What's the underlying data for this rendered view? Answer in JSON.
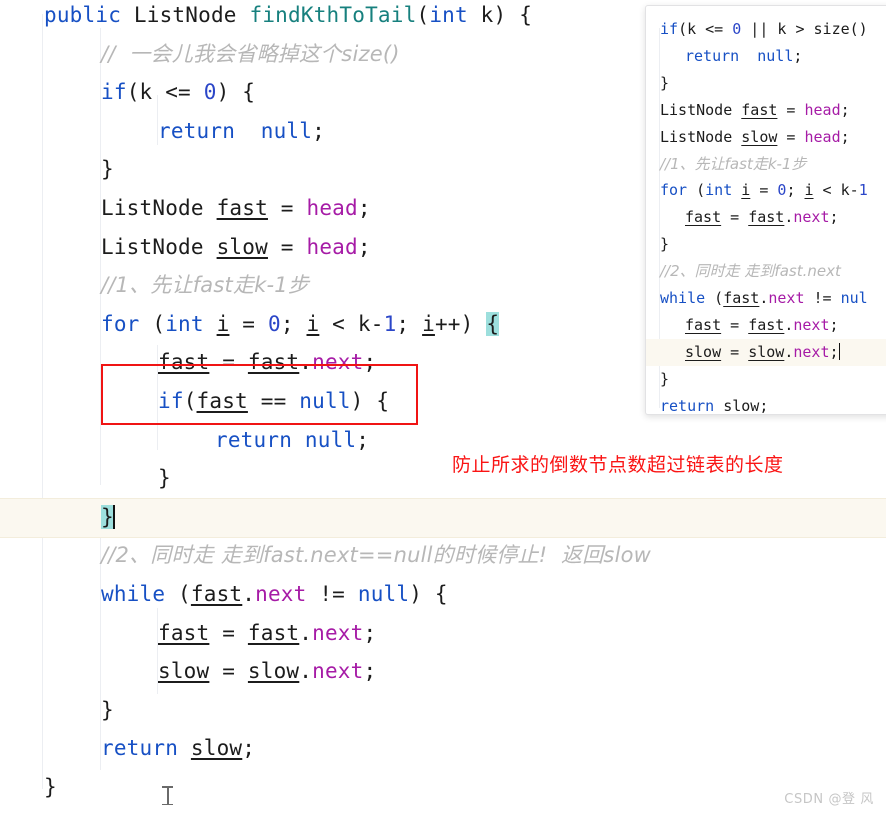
{
  "editor": {
    "language": "java",
    "colors": {
      "keyword": "#1750c4",
      "number": "#2b46c8",
      "method": "#17807e",
      "field": "#a61ba6",
      "comment": "#b7b7b7",
      "text": "#1c1c1c",
      "brace_match_highlight": "#9ddfdd",
      "current_line": "#fbf8f0",
      "annotation_red": "#f01414",
      "background": "#ffffff"
    },
    "lines": [
      {
        "n": 1,
        "indent": 0,
        "segments": [
          {
            "t": "public",
            "c": "kw"
          },
          {
            "t": " ",
            "c": "plain"
          },
          {
            "t": "ListNode",
            "c": "plain"
          },
          {
            "t": " ",
            "c": "plain"
          },
          {
            "t": "findKthToTail",
            "c": "fn"
          },
          {
            "t": "(",
            "c": "plain"
          },
          {
            "t": "int",
            "c": "kw"
          },
          {
            "t": " k) {",
            "c": "plain"
          }
        ]
      },
      {
        "n": 2,
        "indent": 1,
        "segments": [
          {
            "t": "//  一会儿我会省略掉这个size()",
            "c": "cmt"
          }
        ]
      },
      {
        "n": 3,
        "indent": 1,
        "segments": [
          {
            "t": "if",
            "c": "kw"
          },
          {
            "t": "(k <= ",
            "c": "plain"
          },
          {
            "t": "0",
            "c": "num"
          },
          {
            "t": ") {",
            "c": "plain"
          }
        ]
      },
      {
        "n": 4,
        "indent": 2,
        "segments": [
          {
            "t": "return",
            "c": "kw"
          },
          {
            "t": "  ",
            "c": "plain"
          },
          {
            "t": "null",
            "c": "kw"
          },
          {
            "t": ";",
            "c": "plain"
          }
        ]
      },
      {
        "n": 5,
        "indent": 1,
        "segments": [
          {
            "t": "}",
            "c": "plain"
          }
        ]
      },
      {
        "n": 6,
        "indent": 1,
        "segments": [
          {
            "t": "ListNode ",
            "c": "plain"
          },
          {
            "t": "fast",
            "c": "var"
          },
          {
            "t": " = ",
            "c": "plain"
          },
          {
            "t": "head",
            "c": "fld"
          },
          {
            "t": ";",
            "c": "plain"
          }
        ]
      },
      {
        "n": 7,
        "indent": 1,
        "segments": [
          {
            "t": "ListNode ",
            "c": "plain"
          },
          {
            "t": "slow",
            "c": "var"
          },
          {
            "t": " = ",
            "c": "plain"
          },
          {
            "t": "head",
            "c": "fld"
          },
          {
            "t": ";",
            "c": "plain"
          }
        ]
      },
      {
        "n": 8,
        "indent": 1,
        "segments": [
          {
            "t": "//1、先让fast走k-1步",
            "c": "cmt"
          }
        ]
      },
      {
        "n": 9,
        "indent": 1,
        "segments": [
          {
            "t": "for",
            "c": "kw"
          },
          {
            "t": " (",
            "c": "plain"
          },
          {
            "t": "int",
            "c": "kw"
          },
          {
            "t": " ",
            "c": "plain"
          },
          {
            "t": "i",
            "c": "var"
          },
          {
            "t": " = ",
            "c": "plain"
          },
          {
            "t": "0",
            "c": "num"
          },
          {
            "t": "; ",
            "c": "plain"
          },
          {
            "t": "i",
            "c": "var"
          },
          {
            "t": " < k-",
            "c": "plain"
          },
          {
            "t": "1",
            "c": "num"
          },
          {
            "t": "; ",
            "c": "plain"
          },
          {
            "t": "i",
            "c": "var"
          },
          {
            "t": "++) ",
            "c": "plain"
          },
          {
            "t": "{",
            "c": "brace-hl"
          }
        ]
      },
      {
        "n": 10,
        "indent": 2,
        "segments": [
          {
            "t": "fast",
            "c": "var"
          },
          {
            "t": " = ",
            "c": "plain"
          },
          {
            "t": "fast",
            "c": "var"
          },
          {
            "t": ".",
            "c": "plain"
          },
          {
            "t": "next",
            "c": "fld"
          },
          {
            "t": ";",
            "c": "plain"
          }
        ]
      },
      {
        "n": 11,
        "indent": 2,
        "segments": [
          {
            "t": "if",
            "c": "kw"
          },
          {
            "t": "(",
            "c": "plain"
          },
          {
            "t": "fast",
            "c": "var"
          },
          {
            "t": " == ",
            "c": "plain"
          },
          {
            "t": "null",
            "c": "kw"
          },
          {
            "t": ") {",
            "c": "plain"
          }
        ]
      },
      {
        "n": 12,
        "indent": 3,
        "segments": [
          {
            "t": "return",
            "c": "kw"
          },
          {
            "t": " ",
            "c": "plain"
          },
          {
            "t": "null",
            "c": "kw"
          },
          {
            "t": ";",
            "c": "plain"
          }
        ]
      },
      {
        "n": 13,
        "indent": 2,
        "segments": [
          {
            "t": "}",
            "c": "plain"
          }
        ]
      },
      {
        "n": 14,
        "indent": 1,
        "segments": [
          {
            "t": "}",
            "c": "brace-hl"
          }
        ],
        "caret": true,
        "current": true
      },
      {
        "n": 15,
        "indent": 1,
        "segments": [
          {
            "t": "//2、同时走 走到fast.next==null的时候停止!  返回slow",
            "c": "cmt"
          }
        ]
      },
      {
        "n": 16,
        "indent": 1,
        "segments": [
          {
            "t": "while",
            "c": "kw"
          },
          {
            "t": " (",
            "c": "plain"
          },
          {
            "t": "fast",
            "c": "var"
          },
          {
            "t": ".",
            "c": "plain"
          },
          {
            "t": "next",
            "c": "fld"
          },
          {
            "t": " != ",
            "c": "plain"
          },
          {
            "t": "null",
            "c": "kw"
          },
          {
            "t": ") {",
            "c": "plain"
          }
        ]
      },
      {
        "n": 17,
        "indent": 2,
        "segments": [
          {
            "t": "fast",
            "c": "var"
          },
          {
            "t": " = ",
            "c": "plain"
          },
          {
            "t": "fast",
            "c": "var"
          },
          {
            "t": ".",
            "c": "plain"
          },
          {
            "t": "next",
            "c": "fld"
          },
          {
            "t": ";",
            "c": "plain"
          }
        ]
      },
      {
        "n": 18,
        "indent": 2,
        "segments": [
          {
            "t": "slow",
            "c": "var"
          },
          {
            "t": " = ",
            "c": "plain"
          },
          {
            "t": "slow",
            "c": "var"
          },
          {
            "t": ".",
            "c": "plain"
          },
          {
            "t": "next",
            "c": "fld"
          },
          {
            "t": ";",
            "c": "plain"
          }
        ]
      },
      {
        "n": 19,
        "indent": 1,
        "segments": [
          {
            "t": "}",
            "c": "plain"
          }
        ]
      },
      {
        "n": 20,
        "indent": 1,
        "segments": [
          {
            "t": "return",
            "c": "kw"
          },
          {
            "t": " ",
            "c": "plain"
          },
          {
            "t": "slow",
            "c": "var"
          },
          {
            "t": ";",
            "c": "plain"
          }
        ]
      },
      {
        "n": 21,
        "indent": 0,
        "segments": [
          {
            "t": "}",
            "c": "plain"
          }
        ]
      }
    ]
  },
  "annotation": {
    "note_text": "防止所求的倒数节点数超过链表的长度",
    "box_label": "if(fast == null) {"
  },
  "popup": {
    "title": "reference-code-snippet",
    "lines": [
      {
        "n": 1,
        "indent": 0,
        "segments": [
          {
            "t": "if",
            "c": "kw"
          },
          {
            "t": "(k <= ",
            "c": "plain"
          },
          {
            "t": "0",
            "c": "num"
          },
          {
            "t": " || k > size()",
            "c": "plain"
          }
        ]
      },
      {
        "n": 2,
        "indent": 1,
        "segments": [
          {
            "t": "return",
            "c": "kw"
          },
          {
            "t": "  ",
            "c": "plain"
          },
          {
            "t": "null",
            "c": "kw"
          },
          {
            "t": ";",
            "c": "plain"
          }
        ]
      },
      {
        "n": 3,
        "indent": 0,
        "segments": [
          {
            "t": "}",
            "c": "plain"
          }
        ]
      },
      {
        "n": 4,
        "indent": 0,
        "segments": [
          {
            "t": "ListNode ",
            "c": "plain"
          },
          {
            "t": "fast",
            "c": "var"
          },
          {
            "t": " = ",
            "c": "plain"
          },
          {
            "t": "head",
            "c": "fld"
          },
          {
            "t": ";",
            "c": "plain"
          }
        ]
      },
      {
        "n": 5,
        "indent": 0,
        "segments": [
          {
            "t": "ListNode ",
            "c": "plain"
          },
          {
            "t": "slow",
            "c": "var"
          },
          {
            "t": " = ",
            "c": "plain"
          },
          {
            "t": "head",
            "c": "fld"
          },
          {
            "t": ";",
            "c": "plain"
          }
        ]
      },
      {
        "n": 6,
        "indent": 0,
        "segments": [
          {
            "t": "//1、先让fast走k-1步",
            "c": "cmt"
          }
        ]
      },
      {
        "n": 7,
        "indent": 0,
        "segments": [
          {
            "t": "for",
            "c": "kw"
          },
          {
            "t": " (",
            "c": "plain"
          },
          {
            "t": "int",
            "c": "kw"
          },
          {
            "t": " ",
            "c": "plain"
          },
          {
            "t": "i",
            "c": "var"
          },
          {
            "t": " = ",
            "c": "plain"
          },
          {
            "t": "0",
            "c": "num"
          },
          {
            "t": "; ",
            "c": "plain"
          },
          {
            "t": "i",
            "c": "var"
          },
          {
            "t": " < k-",
            "c": "plain"
          },
          {
            "t": "1",
            "c": "num"
          }
        ]
      },
      {
        "n": 8,
        "indent": 1,
        "segments": [
          {
            "t": "fast",
            "c": "var"
          },
          {
            "t": " = ",
            "c": "plain"
          },
          {
            "t": "fast",
            "c": "var"
          },
          {
            "t": ".",
            "c": "plain"
          },
          {
            "t": "next",
            "c": "fld"
          },
          {
            "t": ";",
            "c": "plain"
          }
        ]
      },
      {
        "n": 9,
        "indent": 0,
        "segments": [
          {
            "t": "}",
            "c": "plain"
          }
        ]
      },
      {
        "n": 10,
        "indent": 0,
        "segments": [
          {
            "t": "//2、同时走 走到fast.next",
            "c": "cmt"
          }
        ]
      },
      {
        "n": 11,
        "indent": 0,
        "segments": [
          {
            "t": "while",
            "c": "kw"
          },
          {
            "t": " (",
            "c": "plain"
          },
          {
            "t": "fast",
            "c": "var"
          },
          {
            "t": ".",
            "c": "plain"
          },
          {
            "t": "next",
            "c": "fld"
          },
          {
            "t": " != ",
            "c": "plain"
          },
          {
            "t": "nul",
            "c": "kw"
          }
        ]
      },
      {
        "n": 12,
        "indent": 1,
        "segments": [
          {
            "t": "fast",
            "c": "var"
          },
          {
            "t": " = ",
            "c": "plain"
          },
          {
            "t": "fast",
            "c": "var"
          },
          {
            "t": ".",
            "c": "plain"
          },
          {
            "t": "next",
            "c": "fld"
          },
          {
            "t": ";",
            "c": "plain"
          }
        ]
      },
      {
        "n": 13,
        "indent": 1,
        "segments": [
          {
            "t": "slow",
            "c": "var"
          },
          {
            "t": " = ",
            "c": "plain"
          },
          {
            "t": "slow",
            "c": "var"
          },
          {
            "t": ".",
            "c": "plain"
          },
          {
            "t": "next",
            "c": "fld"
          },
          {
            "t": ";",
            "c": "plain"
          }
        ],
        "caret": true,
        "current": true
      },
      {
        "n": 14,
        "indent": 0,
        "segments": [
          {
            "t": "}",
            "c": "plain"
          }
        ]
      },
      {
        "n": 15,
        "indent": 0,
        "segments": [
          {
            "t": "return",
            "c": "kw"
          },
          {
            "t": " ",
            "c": "plain"
          },
          {
            "t": "slow",
            "c": "var"
          },
          {
            "t": ";",
            "c": "plain"
          }
        ]
      }
    ]
  },
  "watermark": {
    "text": "CSDN @登 风"
  }
}
